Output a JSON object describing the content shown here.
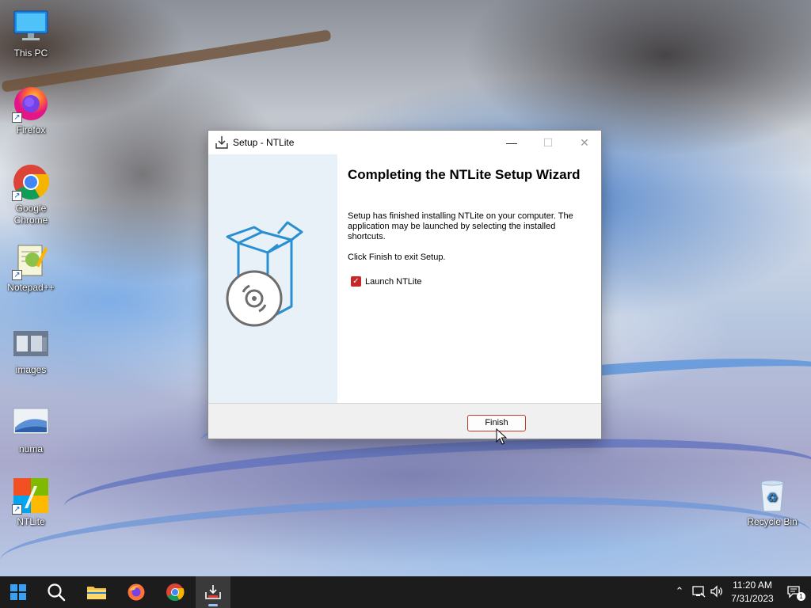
{
  "desktop": {
    "icons": [
      {
        "label": "This PC",
        "icon": "monitor-icon"
      },
      {
        "label": "Firefox",
        "icon": "firefox-icon"
      },
      {
        "label": "Google Chrome",
        "icon": "chrome-icon"
      },
      {
        "label": "Notepad++",
        "icon": "notepadpp-icon"
      },
      {
        "label": "images",
        "icon": "image-folder-icon"
      },
      {
        "label": "numa",
        "icon": "image-file-icon"
      },
      {
        "label": "NTLite",
        "icon": "ntlite-icon"
      },
      {
        "label": "Recycle Bin",
        "icon": "recycle-bin-icon"
      }
    ]
  },
  "dialog": {
    "title": "Setup - NTLite",
    "heading": "Completing the NTLite Setup Wizard",
    "paragraph1": "Setup has finished installing NTLite on your computer. The application may be launched by selecting the installed shortcuts.",
    "paragraph2": "Click Finish to exit Setup.",
    "checkbox_label": "Launch NTLite",
    "checkbox_checked": true,
    "finish_label": "Finish",
    "accent_color": "#c0392b"
  },
  "taskbar": {
    "time": "11:20 AM",
    "date": "7/31/2023",
    "notification_count": "1",
    "pinned": [
      "start-icon",
      "search-icon",
      "file-explorer-icon",
      "firefox-icon",
      "chrome-icon",
      "setup-icon"
    ]
  }
}
